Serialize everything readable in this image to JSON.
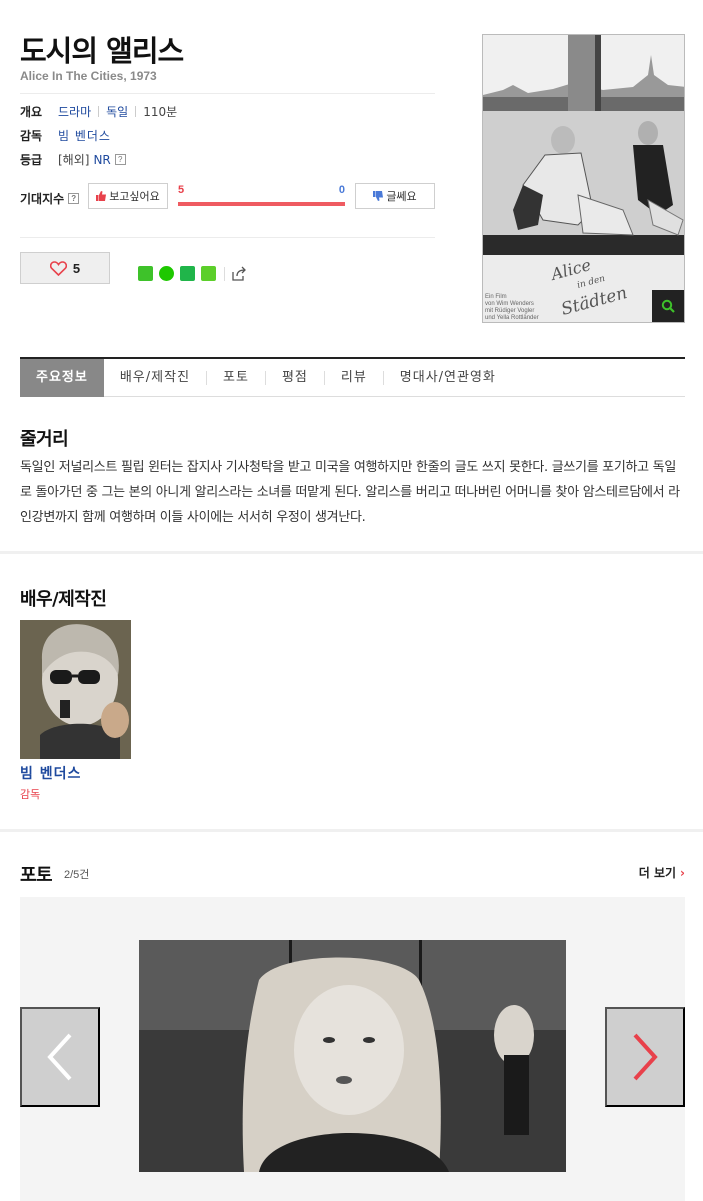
{
  "movie": {
    "title": "도시의 앨리스",
    "subtitle": "Alice In The Cities, 1973"
  },
  "info": {
    "overview_label": "개요",
    "genre": "드라마",
    "country": "독일",
    "runtime": "110분",
    "director_label": "감독",
    "director": "빔 벤더스",
    "rating_label": "등급",
    "rating_region": "[해외]",
    "rating": "NR",
    "help": "?"
  },
  "expectation": {
    "label": "기대지수",
    "want_label": "보고싶어요",
    "meh_label": "글쎄요",
    "want_count": "5",
    "meh_count": "0",
    "want_fraction": 1.0
  },
  "actions": {
    "like_count": "5"
  },
  "colors": {
    "accent_red": "#e8414b",
    "link_blue": "#1f4a9e",
    "tab_active_bg": "#888888"
  },
  "tabs": [
    {
      "label": "주요정보"
    },
    {
      "label": "배우/제작진"
    },
    {
      "label": "포토"
    },
    {
      "label": "평점"
    },
    {
      "label": "리뷰"
    },
    {
      "label": "명대사/연관영화"
    }
  ],
  "synopsis": {
    "heading": "줄거리",
    "text": "독일인 저널리스트 필립 윈터는 잡지사 기사청탁을 받고 미국을 여행하지만 한줄의 글도 쓰지 못한다. 글쓰기를 포기하고 독일로 돌아가던 중 그는 본의 아니게 알리스라는 소녀를 떠맡게 된다. 알리스를 버리고 떠나버린 어머니를 찾아 암스테르담에서 라인강변까지 함께 여행하며 이들 사이에는 서서히 우정이 생겨난다."
  },
  "cast": {
    "heading": "배우/제작진",
    "members": [
      {
        "name": "빔 벤더스",
        "role": "감독"
      }
    ]
  },
  "photos": {
    "heading": "포토",
    "count": "2/5건",
    "more_label": "더 보기",
    "more_arrow": "›"
  },
  "poster": {
    "title_art_line1": "Alice",
    "title_art_line2": "in den",
    "title_art_line3": "Städten",
    "credits": [
      "Ein Film",
      "von Wim Wenders",
      "mit Rüdiger Vogler",
      "und Yella Rottländer"
    ]
  }
}
